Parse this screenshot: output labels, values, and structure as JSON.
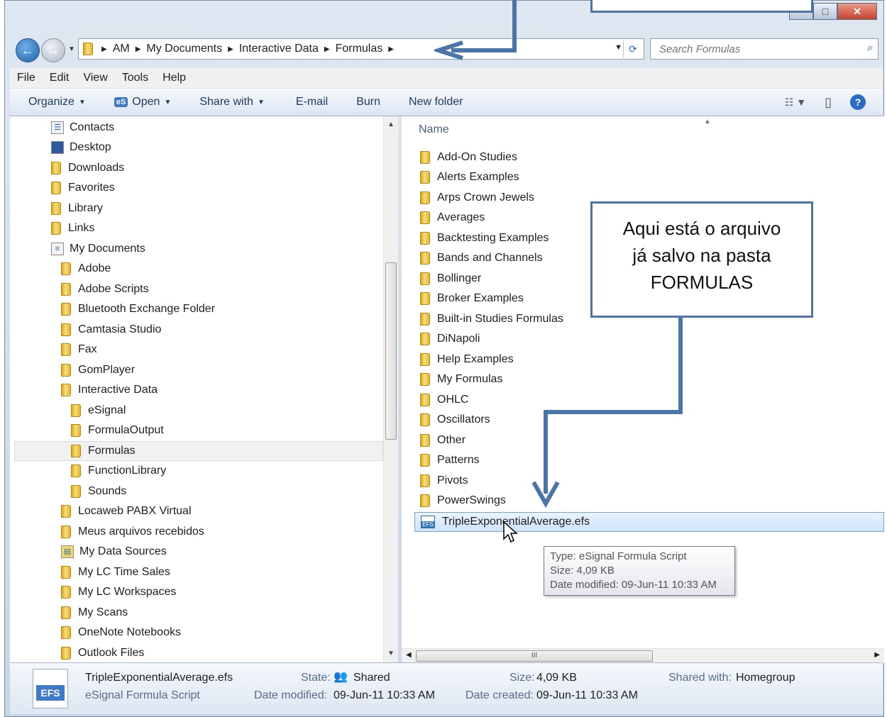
{
  "address": {
    "crumbs": [
      "AM",
      "My Documents",
      "Interactive Data",
      "Formulas"
    ]
  },
  "search": {
    "placeholder": "Search Formulas"
  },
  "menubar": [
    "File",
    "Edit",
    "View",
    "Tools",
    "Help"
  ],
  "toolbar": {
    "organize": "Organize",
    "open": "Open",
    "open_badge": "eS",
    "share_with": "Share with",
    "email": "E-mail",
    "burn": "Burn",
    "new_folder": "New folder"
  },
  "nav_tree": [
    "Contacts",
    "Desktop",
    "Downloads",
    "Favorites",
    "Library",
    "Links",
    "My Documents",
    "Adobe",
    "Adobe Scripts",
    "Bluetooth Exchange Folder",
    "Camtasia Studio",
    "Fax",
    "GomPlayer",
    "Interactive Data",
    "eSignal",
    "FormulaOutput",
    "Formulas",
    "FunctionLibrary",
    "Sounds",
    "Locaweb PABX Virtual",
    "Meus arquivos recebidos",
    "My Data Sources",
    "My LC Time Sales",
    "My LC Workspaces",
    "My Scans",
    "OneNote Notebooks",
    "Outlook Files"
  ],
  "column_header": "Name",
  "folders": [
    "Add-On Studies",
    "Alerts Examples",
    "Arps Crown Jewels",
    "Averages",
    "Backtesting Examples",
    "Bands and Channels",
    "Bollinger",
    "Broker Examples",
    "Built-in Studies Formulas",
    "DiNapoli",
    "Help Examples",
    "My Formulas",
    "OHLC",
    "Oscillators",
    "Other",
    "Patterns",
    "Pivots",
    "PowerSwings"
  ],
  "file": {
    "name": "TripleExponentialAverage.efs",
    "icon_text": "EFS"
  },
  "tooltip": {
    "type": "Type: eSignal Formula Script",
    "size": "Size: 4,09 KB",
    "modified": "Date modified: 09-Jun-11 10:33 AM"
  },
  "details": {
    "filename": "TripleExponentialAverage.efs",
    "filetype": "eSignal Formula Script",
    "state_label": "State:",
    "state_value": "Shared",
    "size_label": "Size:",
    "size_value": "4,09 KB",
    "shared_label": "Shared with:",
    "shared_value": "Homegroup",
    "modified_label": "Date modified:",
    "modified_value": "09-Jun-11 10:33 AM",
    "created_label": "Date created:",
    "created_value": "09-Jun-11 10:33 AM",
    "icon_text": "EFS"
  },
  "callout": {
    "line1": "Aqui está o arquivo",
    "line2": "já salvo na pasta",
    "line3": "FORMULAS"
  },
  "scroll_glyph": "III",
  "accent": "#4b74a8"
}
